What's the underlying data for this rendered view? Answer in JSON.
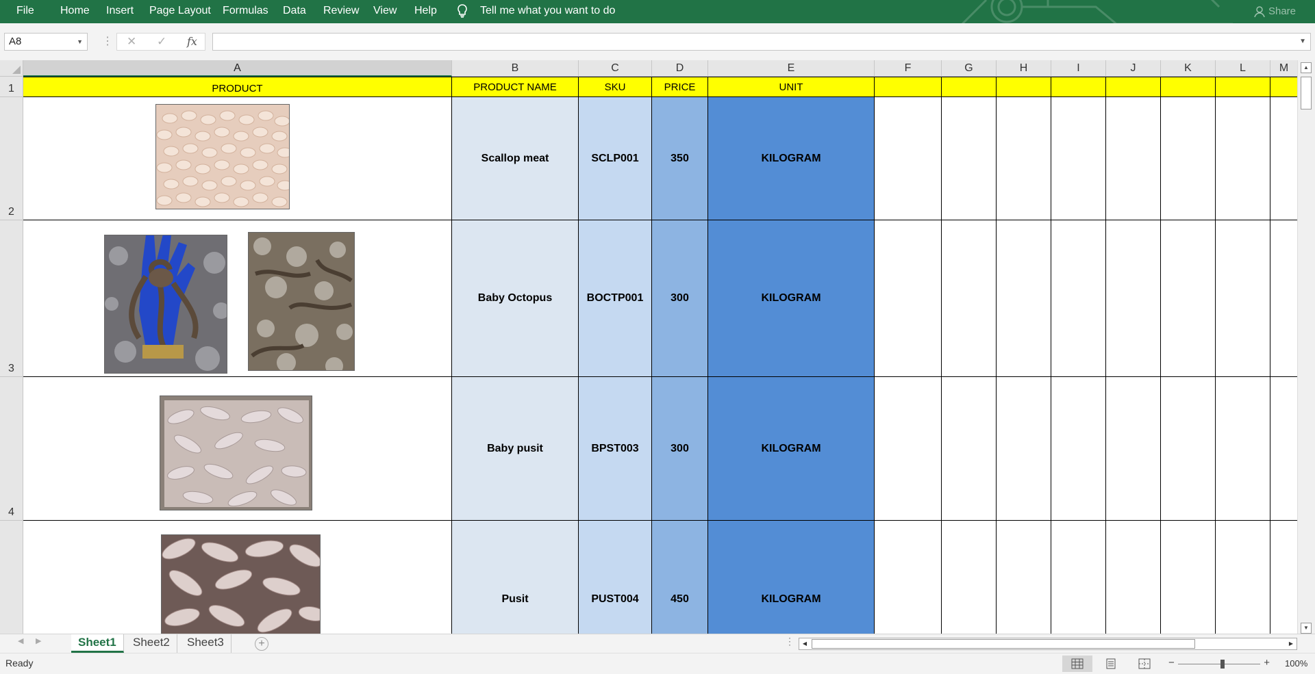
{
  "menu": {
    "items": [
      "File",
      "Home",
      "Insert",
      "Page Layout",
      "Formulas",
      "Data",
      "Review",
      "View",
      "Help"
    ],
    "tell_me": "Tell me what you want to do",
    "share": "Share"
  },
  "formula_bar": {
    "name_box": "A8",
    "cancel": "✕",
    "enter": "✓",
    "fx": "fx",
    "value": ""
  },
  "columns": [
    "A",
    "B",
    "C",
    "D",
    "E",
    "F",
    "G",
    "H",
    "I",
    "J",
    "K",
    "L",
    "M"
  ],
  "rows": [
    "1",
    "2",
    "3",
    "4"
  ],
  "header_row": {
    "product": "PRODUCT",
    "product_name": "PRODUCT NAME",
    "sku": "SKU",
    "price": "PRICE",
    "unit": "UNIT"
  },
  "products": [
    {
      "name": "Scallop meat",
      "sku": "SCLP001",
      "price": "350",
      "unit": "KILOGRAM"
    },
    {
      "name": "Baby Octopus",
      "sku": "BOCTP001",
      "price": "300",
      "unit": "KILOGRAM"
    },
    {
      "name": "Baby pusit",
      "sku": "BPST003",
      "price": "300",
      "unit": "KILOGRAM"
    },
    {
      "name": "Pusit",
      "sku": "PUST004",
      "price": "450",
      "unit": "KILOGRAM"
    }
  ],
  "colors": {
    "excel_green": "#217346",
    "header_yellow": "#ffff00",
    "col_b_fill": "#dce6f1",
    "col_c_fill": "#c5d9f1",
    "col_d_fill": "#8db4e2",
    "col_e_fill": "#538dd5"
  },
  "sheets": [
    "Sheet1",
    "Sheet2",
    "Sheet3"
  ],
  "active_sheet": "Sheet1",
  "status": {
    "ready": "Ready",
    "zoom": "100%"
  }
}
